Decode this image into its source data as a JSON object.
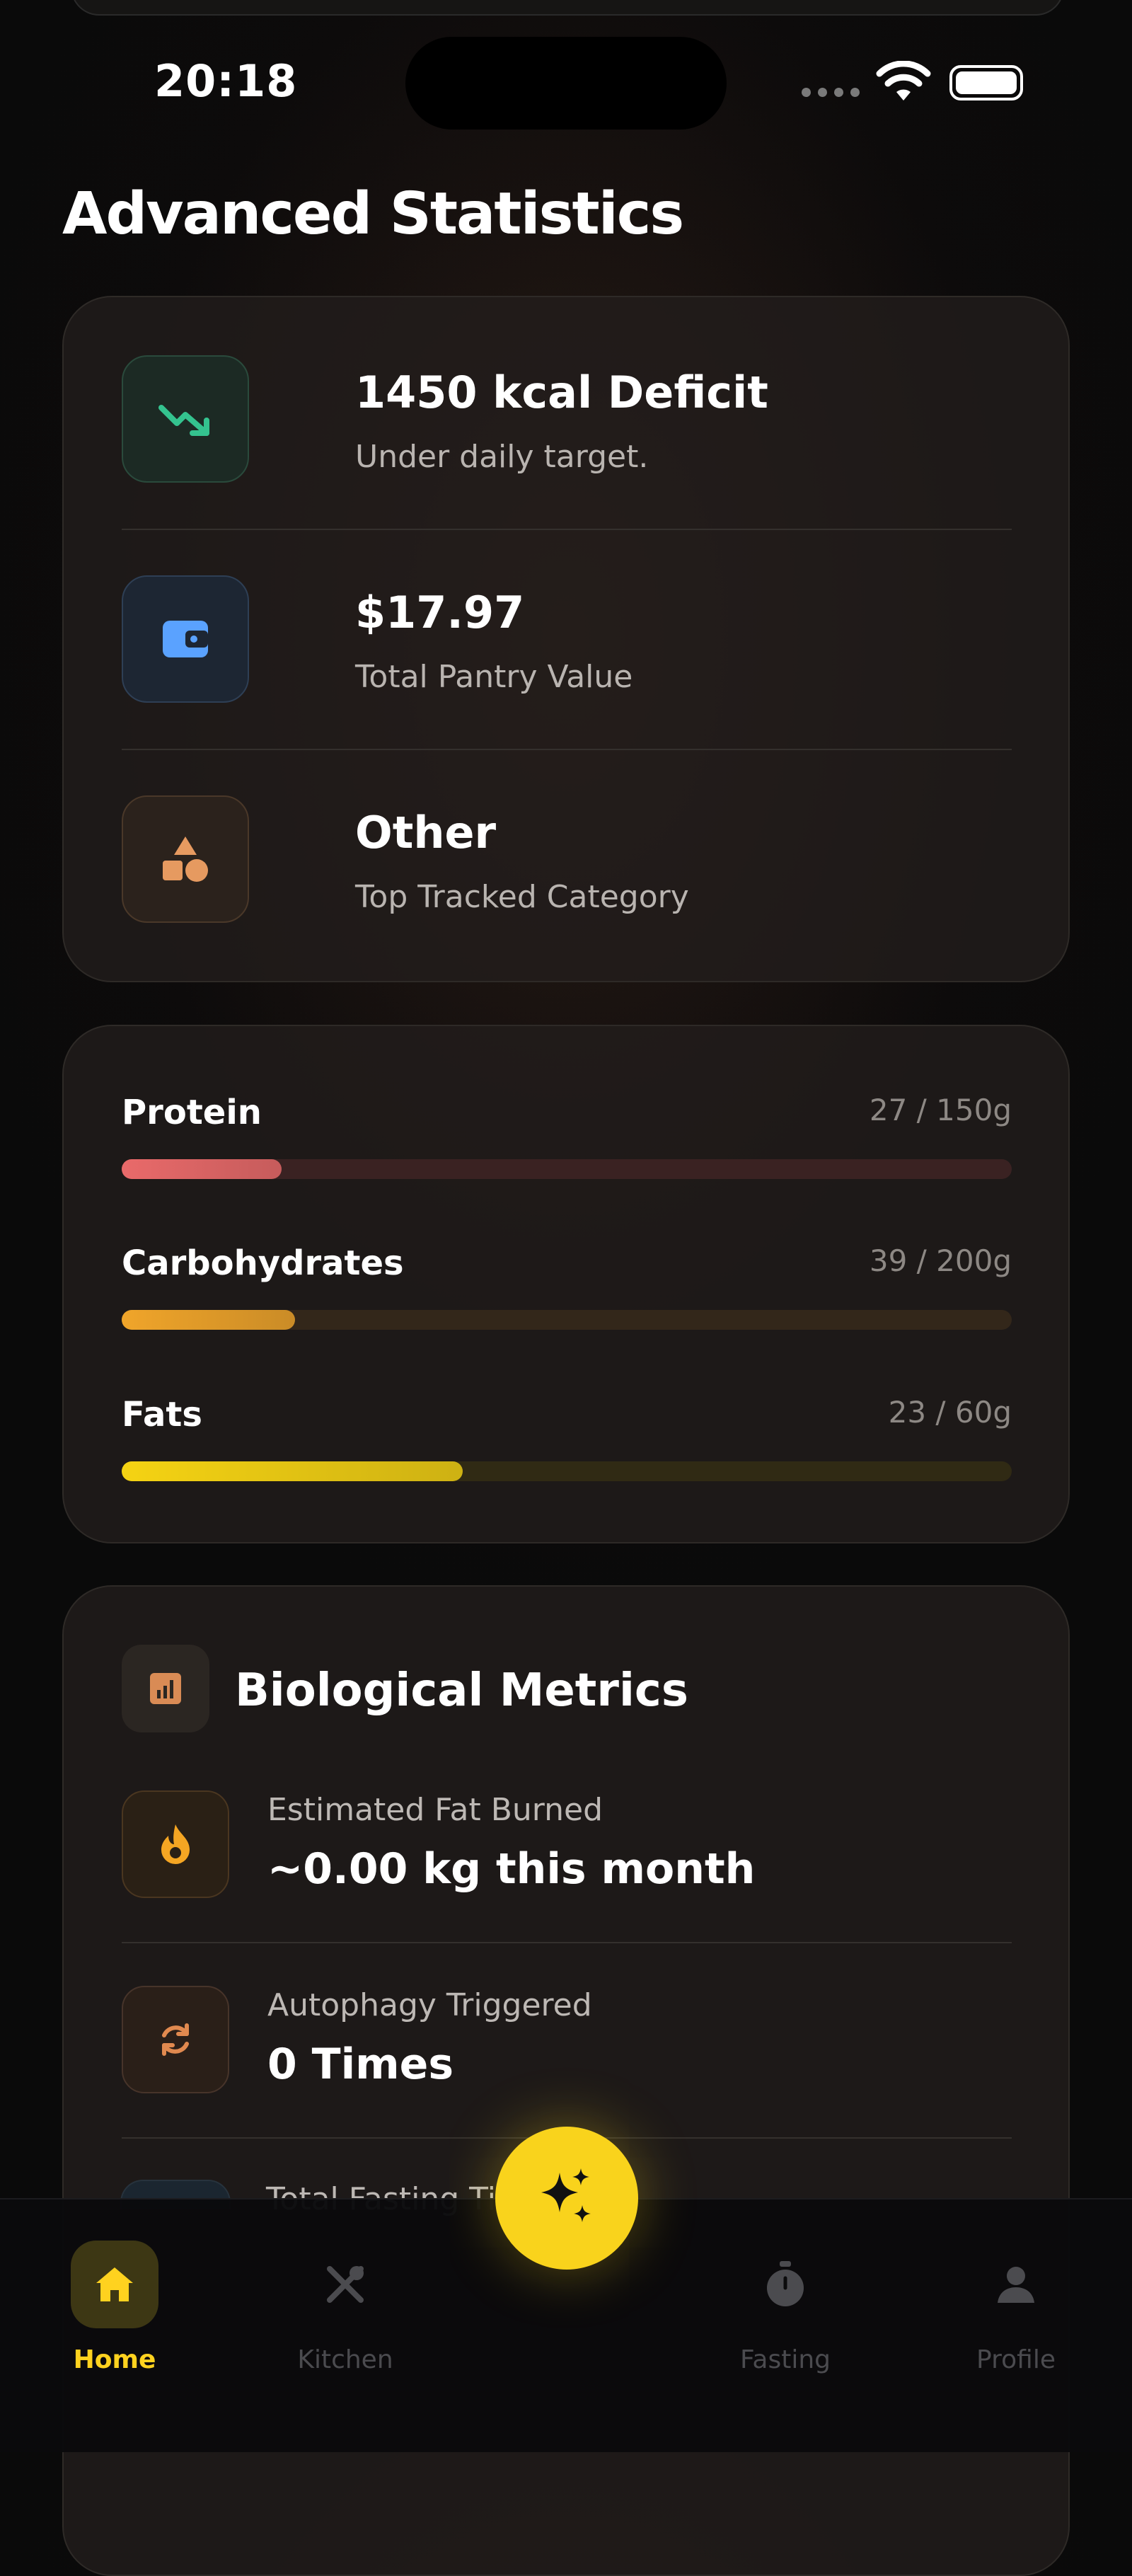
{
  "status_bar": {
    "time": "20:18"
  },
  "page": {
    "title": "Advanced Statistics"
  },
  "summary": [
    {
      "value": "1450 kcal Deficit",
      "label": "Under daily target.",
      "icon": "trending-down-icon"
    },
    {
      "value": "$17.97",
      "label": "Total Pantry Value",
      "icon": "wallet-icon"
    },
    {
      "value": "Other",
      "label": "Top Tracked Category",
      "icon": "shapes-icon"
    }
  ],
  "macros": [
    {
      "name": "Protein",
      "amount": "27 / 150g",
      "progress": 0.18,
      "color": "#e96a6a",
      "track": "#3a2222"
    },
    {
      "name": "Carbohydrates",
      "amount": "39 / 200g",
      "progress": 0.195,
      "color": "#f0a52a",
      "track": "#33271a"
    },
    {
      "name": "Fats",
      "amount": "23 / 60g",
      "progress": 0.383,
      "color": "#f5d313",
      "track": "#302a14"
    }
  ],
  "biological": {
    "title": "Biological Metrics",
    "icon": "bar-chart-icon",
    "rows": [
      {
        "label": "Estimated Fat Burned",
        "value": "~0.00 kg this month",
        "icon": "flame-icon"
      },
      {
        "label": "Autophagy Triggered",
        "value": "0 Times",
        "icon": "refresh-icon"
      },
      {
        "label": "Total Fasting Ti",
        "value": "",
        "icon": "clock-icon"
      }
    ]
  },
  "nav": {
    "items": [
      {
        "label": "Home",
        "icon": "home-icon",
        "active": true
      },
      {
        "label": "Kitchen",
        "icon": "utensils-icon",
        "active": false
      },
      {
        "label": "Fasting",
        "icon": "stopwatch-icon",
        "active": false
      },
      {
        "label": "Profile",
        "icon": "user-icon",
        "active": false
      }
    ],
    "fab_icon": "sparkles-icon"
  },
  "colors": {
    "accent": "#f9d31c",
    "green": "#34c38f",
    "blue": "#5aa2ff",
    "orange": "#e69a60"
  }
}
